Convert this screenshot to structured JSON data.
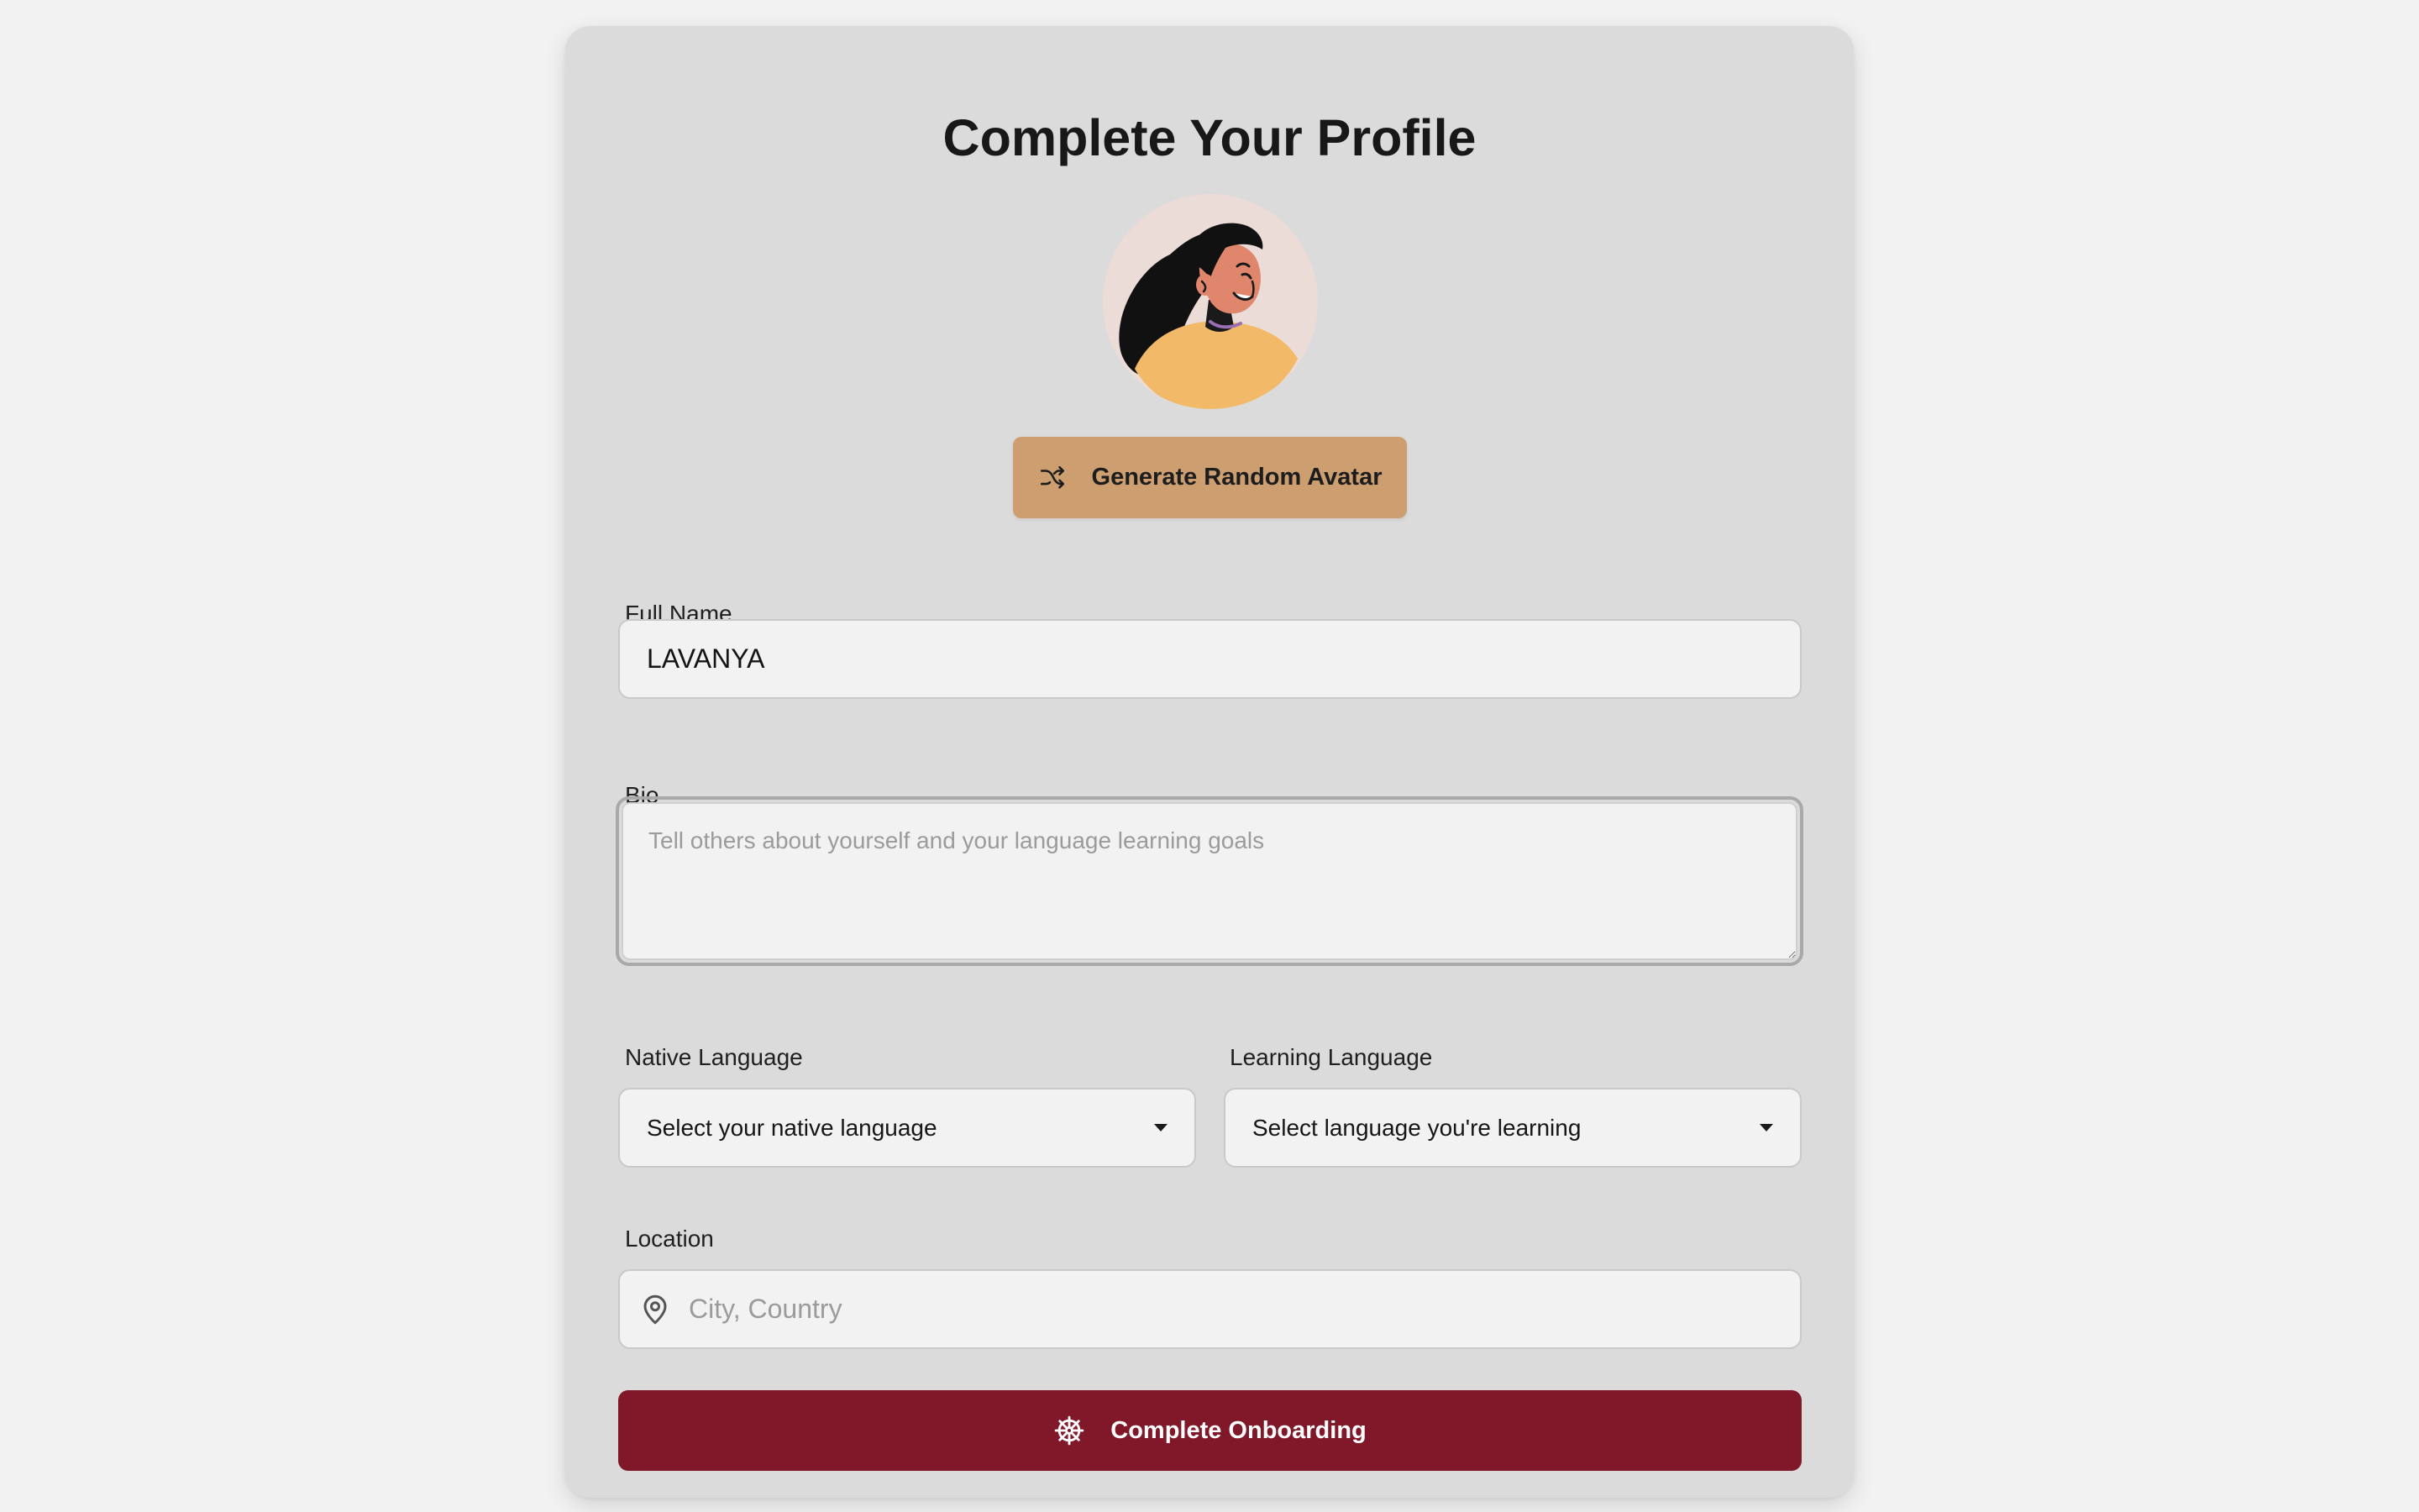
{
  "page": {
    "title": "Complete Your Profile"
  },
  "avatar": {
    "alt": "avatar",
    "random_button_label": "Generate Random Avatar",
    "random_icon": "shuffle-icon"
  },
  "form": {
    "full_name": {
      "label": "Full Name",
      "value": "LAVANYA"
    },
    "bio": {
      "label": "Bio",
      "value": "",
      "placeholder": "Tell others about yourself and your language learning goals"
    },
    "native_language": {
      "label": "Native Language",
      "selected": "Select your native language"
    },
    "learning_language": {
      "label": "Learning Language",
      "selected": "Select language you're learning"
    },
    "location": {
      "label": "Location",
      "value": "",
      "placeholder": "City, Country",
      "icon": "map-pin-icon"
    }
  },
  "submit": {
    "label": "Complete Onboarding",
    "icon": "ship-wheel-icon"
  },
  "colors": {
    "background": "#f2f2f2",
    "card": "#dbdbdb",
    "random_button": "#cc9e70",
    "primary": "#811829",
    "input_background": "#f2f2f2"
  }
}
